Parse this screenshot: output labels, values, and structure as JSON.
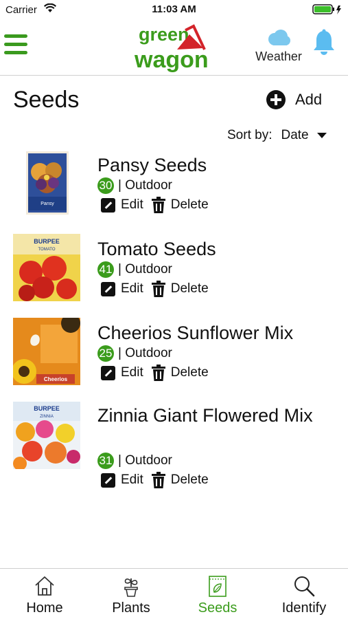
{
  "status_bar": {
    "carrier": "Carrier",
    "time": "11:03 AM"
  },
  "header": {
    "logo_top": "green",
    "logo_bottom": "wagon",
    "weather_label": "Weather"
  },
  "page": {
    "title": "Seeds",
    "add_label": "Add",
    "sort_label": "Sort by:",
    "sort_value": "Date"
  },
  "seeds": [
    {
      "name": "Pansy Seeds",
      "count": "30",
      "location": "| Outdoor",
      "edit": "Edit",
      "delete": "Delete"
    },
    {
      "name": "Tomato Seeds",
      "count": "41",
      "location": "| Outdoor",
      "edit": "Edit",
      "delete": "Delete"
    },
    {
      "name": "Cheerios Sunflower Mix",
      "count": "25",
      "location": "| Outdoor",
      "edit": "Edit",
      "delete": "Delete"
    },
    {
      "name": "Zinnia Giant Flowered Mix",
      "count": "31",
      "location": "| Outdoor",
      "edit": "Edit",
      "delete": "Delete"
    }
  ],
  "packets": [
    {
      "brand": "",
      "text": "Pansy"
    },
    {
      "brand": "BURPEE",
      "text": "TOMATO"
    },
    {
      "brand": "",
      "text": "Cheerios"
    },
    {
      "brand": "BURPEE",
      "text": "ZINNIA"
    }
  ],
  "tabs": [
    {
      "label": "Home",
      "icon": "home-icon"
    },
    {
      "label": "Plants",
      "icon": "plant-icon"
    },
    {
      "label": "Seeds",
      "icon": "seed-packet-icon"
    },
    {
      "label": "Identify",
      "icon": "search-icon"
    }
  ],
  "colors": {
    "brand_green": "#3b9c1c",
    "accent_blue": "#5bbcf0",
    "logo_red": "#d3242a"
  }
}
